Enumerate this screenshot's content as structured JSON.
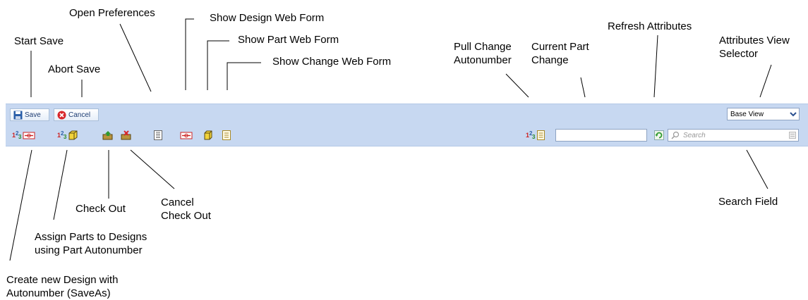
{
  "callouts": {
    "start_save": "Start Save",
    "abort_save": "Abort Save",
    "open_preferences": "Open Preferences",
    "show_design_web_form": "Show Design Web Form",
    "show_part_web_form": "Show Part Web Form",
    "show_change_web_form": "Show Change Web Form",
    "pull_change_autonumber": [
      "Pull Change",
      "Autonumber"
    ],
    "current_part_change": [
      "Current Part",
      "Change"
    ],
    "refresh_attributes": "Refresh Attributes",
    "attributes_view_selector": [
      "Attributes View",
      "Selector"
    ],
    "check_out": "Check Out",
    "cancel_check_out": [
      "Cancel",
      "Check Out"
    ],
    "assign_parts": [
      "Assign Parts to Designs",
      "using Part Autonumber"
    ],
    "create_new_design": [
      "Create new Design with",
      "Autonumber (SaveAs)"
    ],
    "search_field": "Search Field"
  },
  "toolbar": {
    "save_label": "Save",
    "cancel_label": "Cancel",
    "view_selected": "Base View",
    "change_value": "",
    "search_placeholder": "Search"
  },
  "colors": {
    "toolbar_bg": "#c7d8f1",
    "save_icon": "#2a5ea8",
    "cancel_icon": "#d8262b",
    "check_icon": "#8a6d2b",
    "refresh_icon": "#2e9a2e"
  }
}
